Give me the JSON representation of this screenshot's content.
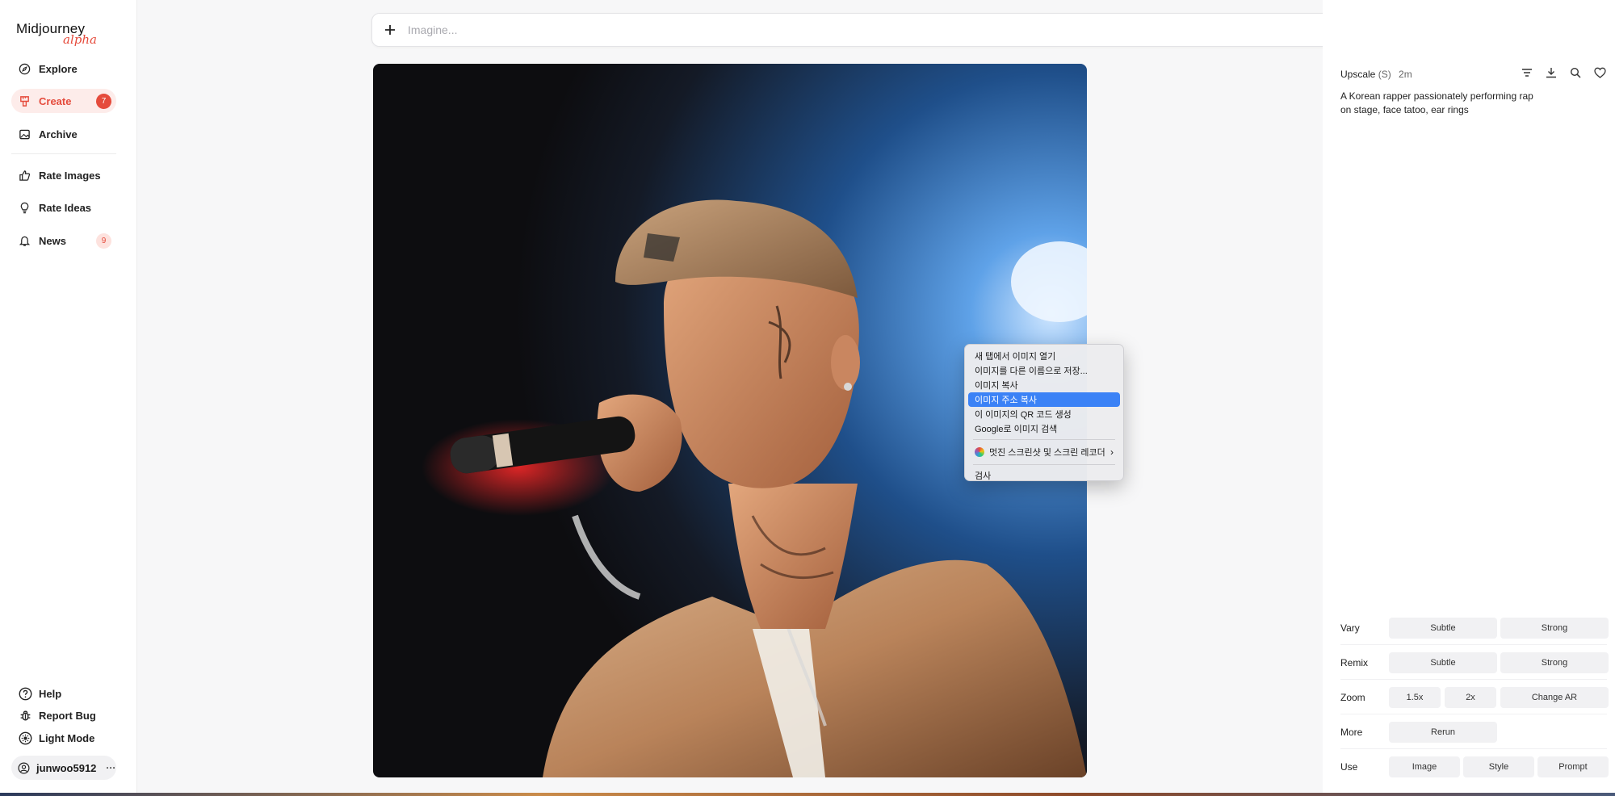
{
  "app": {
    "logo": "Midjourney",
    "logo_sub": "alpha"
  },
  "sidebar": {
    "items": [
      {
        "label": "Explore",
        "icon": "compass-icon"
      },
      {
        "label": "Create",
        "icon": "brush-icon",
        "badge": "7",
        "active": true
      },
      {
        "label": "Archive",
        "icon": "image-icon"
      },
      {
        "label": "Rate Images",
        "icon": "thumbs-up-icon"
      },
      {
        "label": "Rate Ideas",
        "icon": "lightbulb-icon"
      },
      {
        "label": "News",
        "icon": "bell-icon",
        "badge": "9"
      }
    ],
    "footer": [
      {
        "label": "Help",
        "icon": "question-icon"
      },
      {
        "label": "Report Bug",
        "icon": "bug-icon"
      },
      {
        "label": "Light Mode",
        "icon": "sun-icon"
      }
    ],
    "user": {
      "name": "junwoo5912",
      "more": "···"
    }
  },
  "search": {
    "placeholder": "Imagine..."
  },
  "context_menu": {
    "items": [
      "새 탭에서 이미지 열기",
      "이미지를 다른 이름으로 저장...",
      "이미지 복사",
      "이미지 주소 복사",
      "이 이미지의 QR 코드 생성",
      "Google로 이미지 검색"
    ],
    "highlighted_index": 3,
    "extension": "멋진 스크린샷 및 스크린 레코더",
    "inspect": "검사"
  },
  "panel": {
    "title": "Upscale",
    "title_sub": "(S)",
    "time": "2m",
    "prompt": "A Korean rapper passionately performing rap on stage, face tatoo, ear rings",
    "rows": [
      {
        "label": "Vary",
        "buttons": [
          "Subtle",
          "Strong"
        ]
      },
      {
        "label": "Remix",
        "buttons": [
          "Subtle",
          "Strong"
        ]
      },
      {
        "label": "Zoom",
        "buttons": [
          "1.5x",
          "2x",
          "Change AR"
        ]
      },
      {
        "label": "More",
        "buttons": [
          "Rerun"
        ]
      },
      {
        "label": "Use",
        "buttons": [
          "Image",
          "Style",
          "Prompt"
        ]
      }
    ]
  },
  "colors": {
    "accent": "#e54b3c",
    "highlight": "#3b82f6"
  }
}
